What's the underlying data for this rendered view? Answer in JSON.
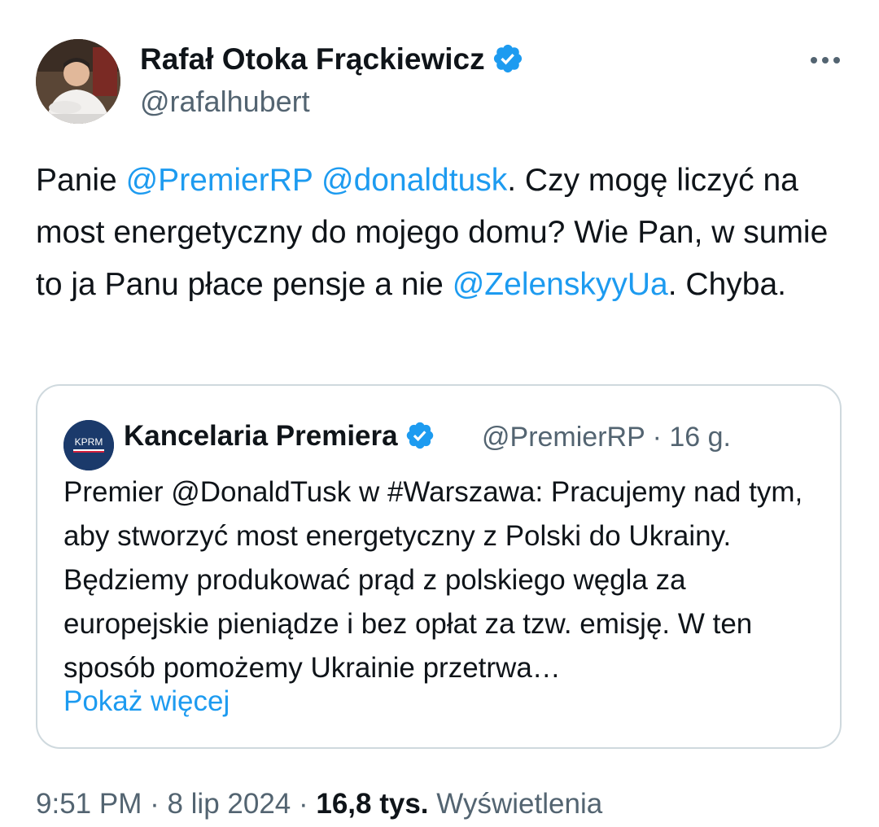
{
  "author": {
    "name": "Rafał Otoka Frąckiewicz",
    "handle": "@rafalhubert"
  },
  "tweet": {
    "text_1": "Panie ",
    "mention_1": "@PremierRP",
    "text_2": " ",
    "mention_2": "@donaldtusk",
    "text_3": ". Czy mogę liczyć na most energetyczny do mojego domu? Wie Pan, w sumie to ja Panu płace pensje a nie ",
    "mention_3": "@ZelenskyyUa",
    "text_4": ". Chyba."
  },
  "quoted": {
    "avatar_text": "KPRM",
    "name": "Kancelaria Premiera",
    "handle": "@PremierRP · 16 g.",
    "text": "Premier @DonaldTusk w #Warszawa: Pracujemy nad tym, aby stworzyć most energetyczny z Polski do Ukrainy. Będziemy produkować prąd z polskiego węgla za europejskie pieniądze i bez opłat za tzw. emisję. W ten sposób pomożemy Ukrainie przetrwa…",
    "show_more": "Pokaż więcej"
  },
  "meta": {
    "time": "9:51 PM",
    "date": "8 lip 2024",
    "views_count": "16,8 tys.",
    "views_label": "Wyświetlenia",
    "separator": " · "
  },
  "icons": {
    "verified": "verified-badge-icon",
    "more": "more-horizontal-icon"
  },
  "colors": {
    "link": "#1d9bf0",
    "secondary_text": "#536471",
    "border": "#cfd9de"
  }
}
